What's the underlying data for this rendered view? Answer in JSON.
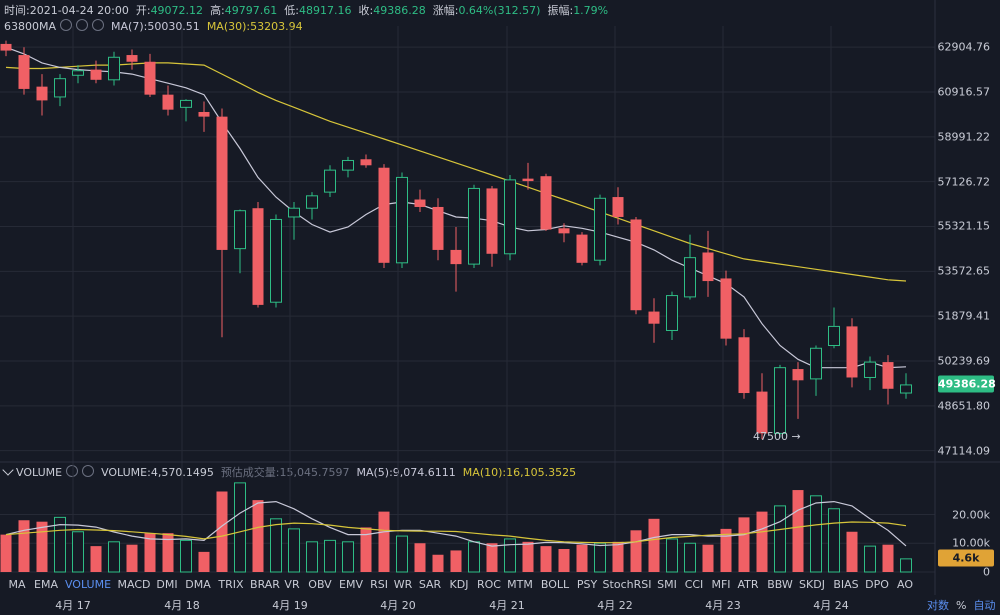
{
  "header": {
    "time_label": "时间:",
    "time_value": "2021-04-24 20:00",
    "open_label": "开:",
    "open_value": "49072.12",
    "high_label": "高:",
    "high_value": "49797.61",
    "low_label": "低:",
    "low_value": "48917.16",
    "close_label": "收:",
    "close_value": "49386.28",
    "change_label": "涨幅:",
    "change_value": "0.64%(312.57)",
    "amplitude_label": "振幅:",
    "amplitude_value": "1.79%"
  },
  "main_legend": {
    "indicator": "63800MA",
    "ma7": "MA(7):50030.51",
    "ma30": "MA(30):53203.94"
  },
  "volume_legend": {
    "indicator": "VOLUME",
    "volume": "VOLUME:4,570.1495",
    "estimate": "预估成交量:15,045.7597",
    "ma5": "MA(5):9,074.6111",
    "ma10": "MA(10):16,105.3525"
  },
  "colors": {
    "up": "#2ebd85",
    "down": "#f06065",
    "ma7": "#c8c8d8",
    "ma30": "#d7c53a",
    "bg": "#161a25",
    "grid": "#262a36",
    "active_tab": "#5b8ff0"
  },
  "price_axis": [
    "62904.76",
    "60916.57",
    "58991.22",
    "57126.72",
    "55321.15",
    "53572.65",
    "51879.41",
    "50239.69",
    "48651.80",
    "47114.09"
  ],
  "current_price": "49386.28",
  "min_annotation": "47500",
  "volume_axis": [
    "20.00k",
    "10.00k",
    "0"
  ],
  "current_volume": "4.6k",
  "x_axis": [
    "4月 17",
    "4月 18",
    "4月 19",
    "4月 20",
    "4月 21",
    "4月 22",
    "4月 23",
    "4月 24"
  ],
  "indicator_tabs": [
    "MA",
    "EMA",
    "VOLUME",
    "MACD",
    "DMI",
    "DMA",
    "TRIX",
    "BRAR",
    "VR",
    "OBV",
    "EMV",
    "RSI",
    "WR",
    "SAR",
    "KDJ",
    "ROC",
    "MTM",
    "BOLL",
    "PSY",
    "StochRSI",
    "SMI",
    "CCI",
    "MFI",
    "ATR",
    "BBW",
    "SKDJ",
    "BIAS",
    "DPO",
    "AO"
  ],
  "active_tab": "VOLUME",
  "bottom_right": {
    "log": "对数",
    "percent": "%",
    "auto": "自动"
  },
  "chart_data": {
    "type": "candlestick",
    "title": "",
    "y_axis": {
      "scale": "log",
      "range": [
        46800,
        63500
      ]
    },
    "volume_axis_range": [
      0,
      32000
    ],
    "candles": [
      {
        "o": 63050,
        "h": 63200,
        "l": 62500,
        "c": 62750,
        "v": 13000
      },
      {
        "o": 62550,
        "h": 62900,
        "l": 60800,
        "c": 61050,
        "v": 18000
      },
      {
        "o": 61150,
        "h": 61700,
        "l": 59900,
        "c": 60550,
        "v": 17500
      },
      {
        "o": 60700,
        "h": 61700,
        "l": 60300,
        "c": 61500,
        "v": 19000
      },
      {
        "o": 61650,
        "h": 62100,
        "l": 61300,
        "c": 61850,
        "v": 14000
      },
      {
        "o": 61900,
        "h": 62300,
        "l": 61300,
        "c": 61450,
        "v": 9000
      },
      {
        "o": 61450,
        "h": 62700,
        "l": 61200,
        "c": 62450,
        "v": 10500
      },
      {
        "o": 62550,
        "h": 62800,
        "l": 61900,
        "c": 62250,
        "v": 9500
      },
      {
        "o": 62250,
        "h": 62600,
        "l": 60700,
        "c": 60800,
        "v": 13500
      },
      {
        "o": 60800,
        "h": 61200,
        "l": 59900,
        "c": 60150,
        "v": 13500
      },
      {
        "o": 60250,
        "h": 60600,
        "l": 59650,
        "c": 60550,
        "v": 11000
      },
      {
        "o": 60050,
        "h": 60500,
        "l": 59200,
        "c": 59850,
        "v": 7000
      },
      {
        "o": 59850,
        "h": 60200,
        "l": 51100,
        "c": 54400,
        "v": 28000
      },
      {
        "o": 54450,
        "h": 56000,
        "l": 53500,
        "c": 55950,
        "v": 31000
      },
      {
        "o": 56050,
        "h": 56300,
        "l": 52200,
        "c": 52300,
        "v": 25000
      },
      {
        "o": 52400,
        "h": 55800,
        "l": 52200,
        "c": 55600,
        "v": 18500
      },
      {
        "o": 55700,
        "h": 56300,
        "l": 54800,
        "c": 56050,
        "v": 15000
      },
      {
        "o": 56050,
        "h": 56700,
        "l": 55600,
        "c": 56550,
        "v": 10500
      },
      {
        "o": 56700,
        "h": 57800,
        "l": 56500,
        "c": 57600,
        "v": 11000
      },
      {
        "o": 57600,
        "h": 58150,
        "l": 57300,
        "c": 58000,
        "v": 10500
      },
      {
        "o": 58050,
        "h": 58250,
        "l": 57700,
        "c": 57800,
        "v": 15500
      },
      {
        "o": 57700,
        "h": 57850,
        "l": 53700,
        "c": 53900,
        "v": 21000
      },
      {
        "o": 53900,
        "h": 57500,
        "l": 53700,
        "c": 57300,
        "v": 12500
      },
      {
        "o": 56400,
        "h": 56800,
        "l": 55900,
        "c": 56100,
        "v": 10000
      },
      {
        "o": 56100,
        "h": 56450,
        "l": 54000,
        "c": 54400,
        "v": 6000
      },
      {
        "o": 54400,
        "h": 55300,
        "l": 52800,
        "c": 53850,
        "v": 7500
      },
      {
        "o": 53850,
        "h": 57000,
        "l": 53700,
        "c": 56850,
        "v": 10500
      },
      {
        "o": 56850,
        "h": 56950,
        "l": 53750,
        "c": 54250,
        "v": 10000
      },
      {
        "o": 54250,
        "h": 57400,
        "l": 54000,
        "c": 57200,
        "v": 11500
      },
      {
        "o": 57250,
        "h": 57900,
        "l": 56800,
        "c": 57150,
        "v": 10500
      },
      {
        "o": 57350,
        "h": 57450,
        "l": 55150,
        "c": 55200,
        "v": 9000
      },
      {
        "o": 55250,
        "h": 55450,
        "l": 54700,
        "c": 55050,
        "v": 8000
      },
      {
        "o": 55000,
        "h": 55100,
        "l": 53800,
        "c": 53900,
        "v": 9500
      },
      {
        "o": 54000,
        "h": 56600,
        "l": 53800,
        "c": 56450,
        "v": 10000
      },
      {
        "o": 56500,
        "h": 56900,
        "l": 55400,
        "c": 55700,
        "v": 10500
      },
      {
        "o": 55600,
        "h": 55700,
        "l": 51950,
        "c": 52100,
        "v": 14500
      },
      {
        "o": 52050,
        "h": 52550,
        "l": 50900,
        "c": 51600,
        "v": 18500
      },
      {
        "o": 51350,
        "h": 52800,
        "l": 51000,
        "c": 52650,
        "v": 11500
      },
      {
        "o": 52600,
        "h": 55000,
        "l": 52500,
        "c": 54100,
        "v": 10000
      },
      {
        "o": 54300,
        "h": 55150,
        "l": 52600,
        "c": 53200,
        "v": 9500
      },
      {
        "o": 53300,
        "h": 53600,
        "l": 50800,
        "c": 51050,
        "v": 15000
      },
      {
        "o": 51100,
        "h": 51400,
        "l": 48900,
        "c": 49100,
        "v": 19000
      },
      {
        "o": 49150,
        "h": 49800,
        "l": 47500,
        "c": 47700,
        "v": 21000
      },
      {
        "o": 47700,
        "h": 50100,
        "l": 47550,
        "c": 50000,
        "v": 23000
      },
      {
        "o": 49950,
        "h": 50200,
        "l": 48200,
        "c": 49550,
        "v": 28500
      },
      {
        "o": 49600,
        "h": 50800,
        "l": 49000,
        "c": 50700,
        "v": 26500
      },
      {
        "o": 50800,
        "h": 52200,
        "l": 50700,
        "c": 51500,
        "v": 22000
      },
      {
        "o": 51500,
        "h": 51800,
        "l": 49300,
        "c": 49650,
        "v": 14000
      },
      {
        "o": 49650,
        "h": 50400,
        "l": 49200,
        "c": 50200,
        "v": 9000
      },
      {
        "o": 50200,
        "h": 50450,
        "l": 48700,
        "c": 49250,
        "v": 9500
      },
      {
        "o": 49100,
        "h": 49800,
        "l": 48900,
        "c": 49386,
        "v": 4570
      }
    ],
    "ma7": [
      62900,
      62600,
      62200,
      62000,
      61900,
      61850,
      61800,
      61700,
      61500,
      61300,
      61100,
      60800,
      59600,
      58500,
      57300,
      56500,
      55900,
      55400,
      55100,
      55300,
      55800,
      56200,
      56300,
      56200,
      55950,
      55700,
      55650,
      55550,
      55300,
      55150,
      55200,
      55350,
      55250,
      55100,
      54900,
      54700,
      54400,
      54000,
      53700,
      53400,
      53100,
      52600,
      51600,
      50800,
      50300,
      50000,
      50000,
      50000,
      50200,
      50000,
      50030
    ],
    "ma30": [
      62000,
      61950,
      61950,
      62000,
      62050,
      62100,
      62100,
      62150,
      62200,
      62200,
      62150,
      62100,
      61700,
      61300,
      60900,
      60550,
      60250,
      59950,
      59650,
      59400,
      59150,
      58900,
      58650,
      58400,
      58150,
      57900,
      57650,
      57400,
      57150,
      56900,
      56650,
      56400,
      56150,
      55900,
      55650,
      55400,
      55150,
      54900,
      54650,
      54450,
      54250,
      54050,
      53950,
      53850,
      53750,
      53650,
      53550,
      53450,
      53350,
      53250,
      53204
    ],
    "vol_ma5": [
      13000,
      14500,
      15500,
      16500,
      16300,
      15600,
      13900,
      12500,
      11500,
      11300,
      11500,
      11000,
      16000,
      20500,
      24000,
      24500,
      22000,
      18500,
      15500,
      13000,
      13000,
      14000,
      14500,
      14500,
      13500,
      12500,
      10500,
      9000,
      9500,
      9700,
      10300,
      10200,
      9800,
      9200,
      9500,
      10500,
      12000,
      13000,
      13000,
      12500,
      12500,
      13000,
      15000,
      17500,
      21500,
      24000,
      24500,
      23000,
      18500,
      14500,
      9075
    ],
    "vol_ma10": [
      13000,
      13500,
      14000,
      14500,
      14800,
      14600,
      14400,
      14000,
      13500,
      13000,
      12400,
      11500,
      12500,
      14000,
      15500,
      16500,
      17000,
      16800,
      16300,
      15500,
      15000,
      14500,
      14300,
      14200,
      14200,
      14100,
      13500,
      12900,
      12500,
      11700,
      11000,
      10500,
      10300,
      10200,
      10200,
      10500,
      11300,
      12000,
      12400,
      12800,
      13100,
      13300,
      14000,
      14800,
      15600,
      16400,
      17000,
      17400,
      17300,
      17000,
      16105
    ]
  }
}
